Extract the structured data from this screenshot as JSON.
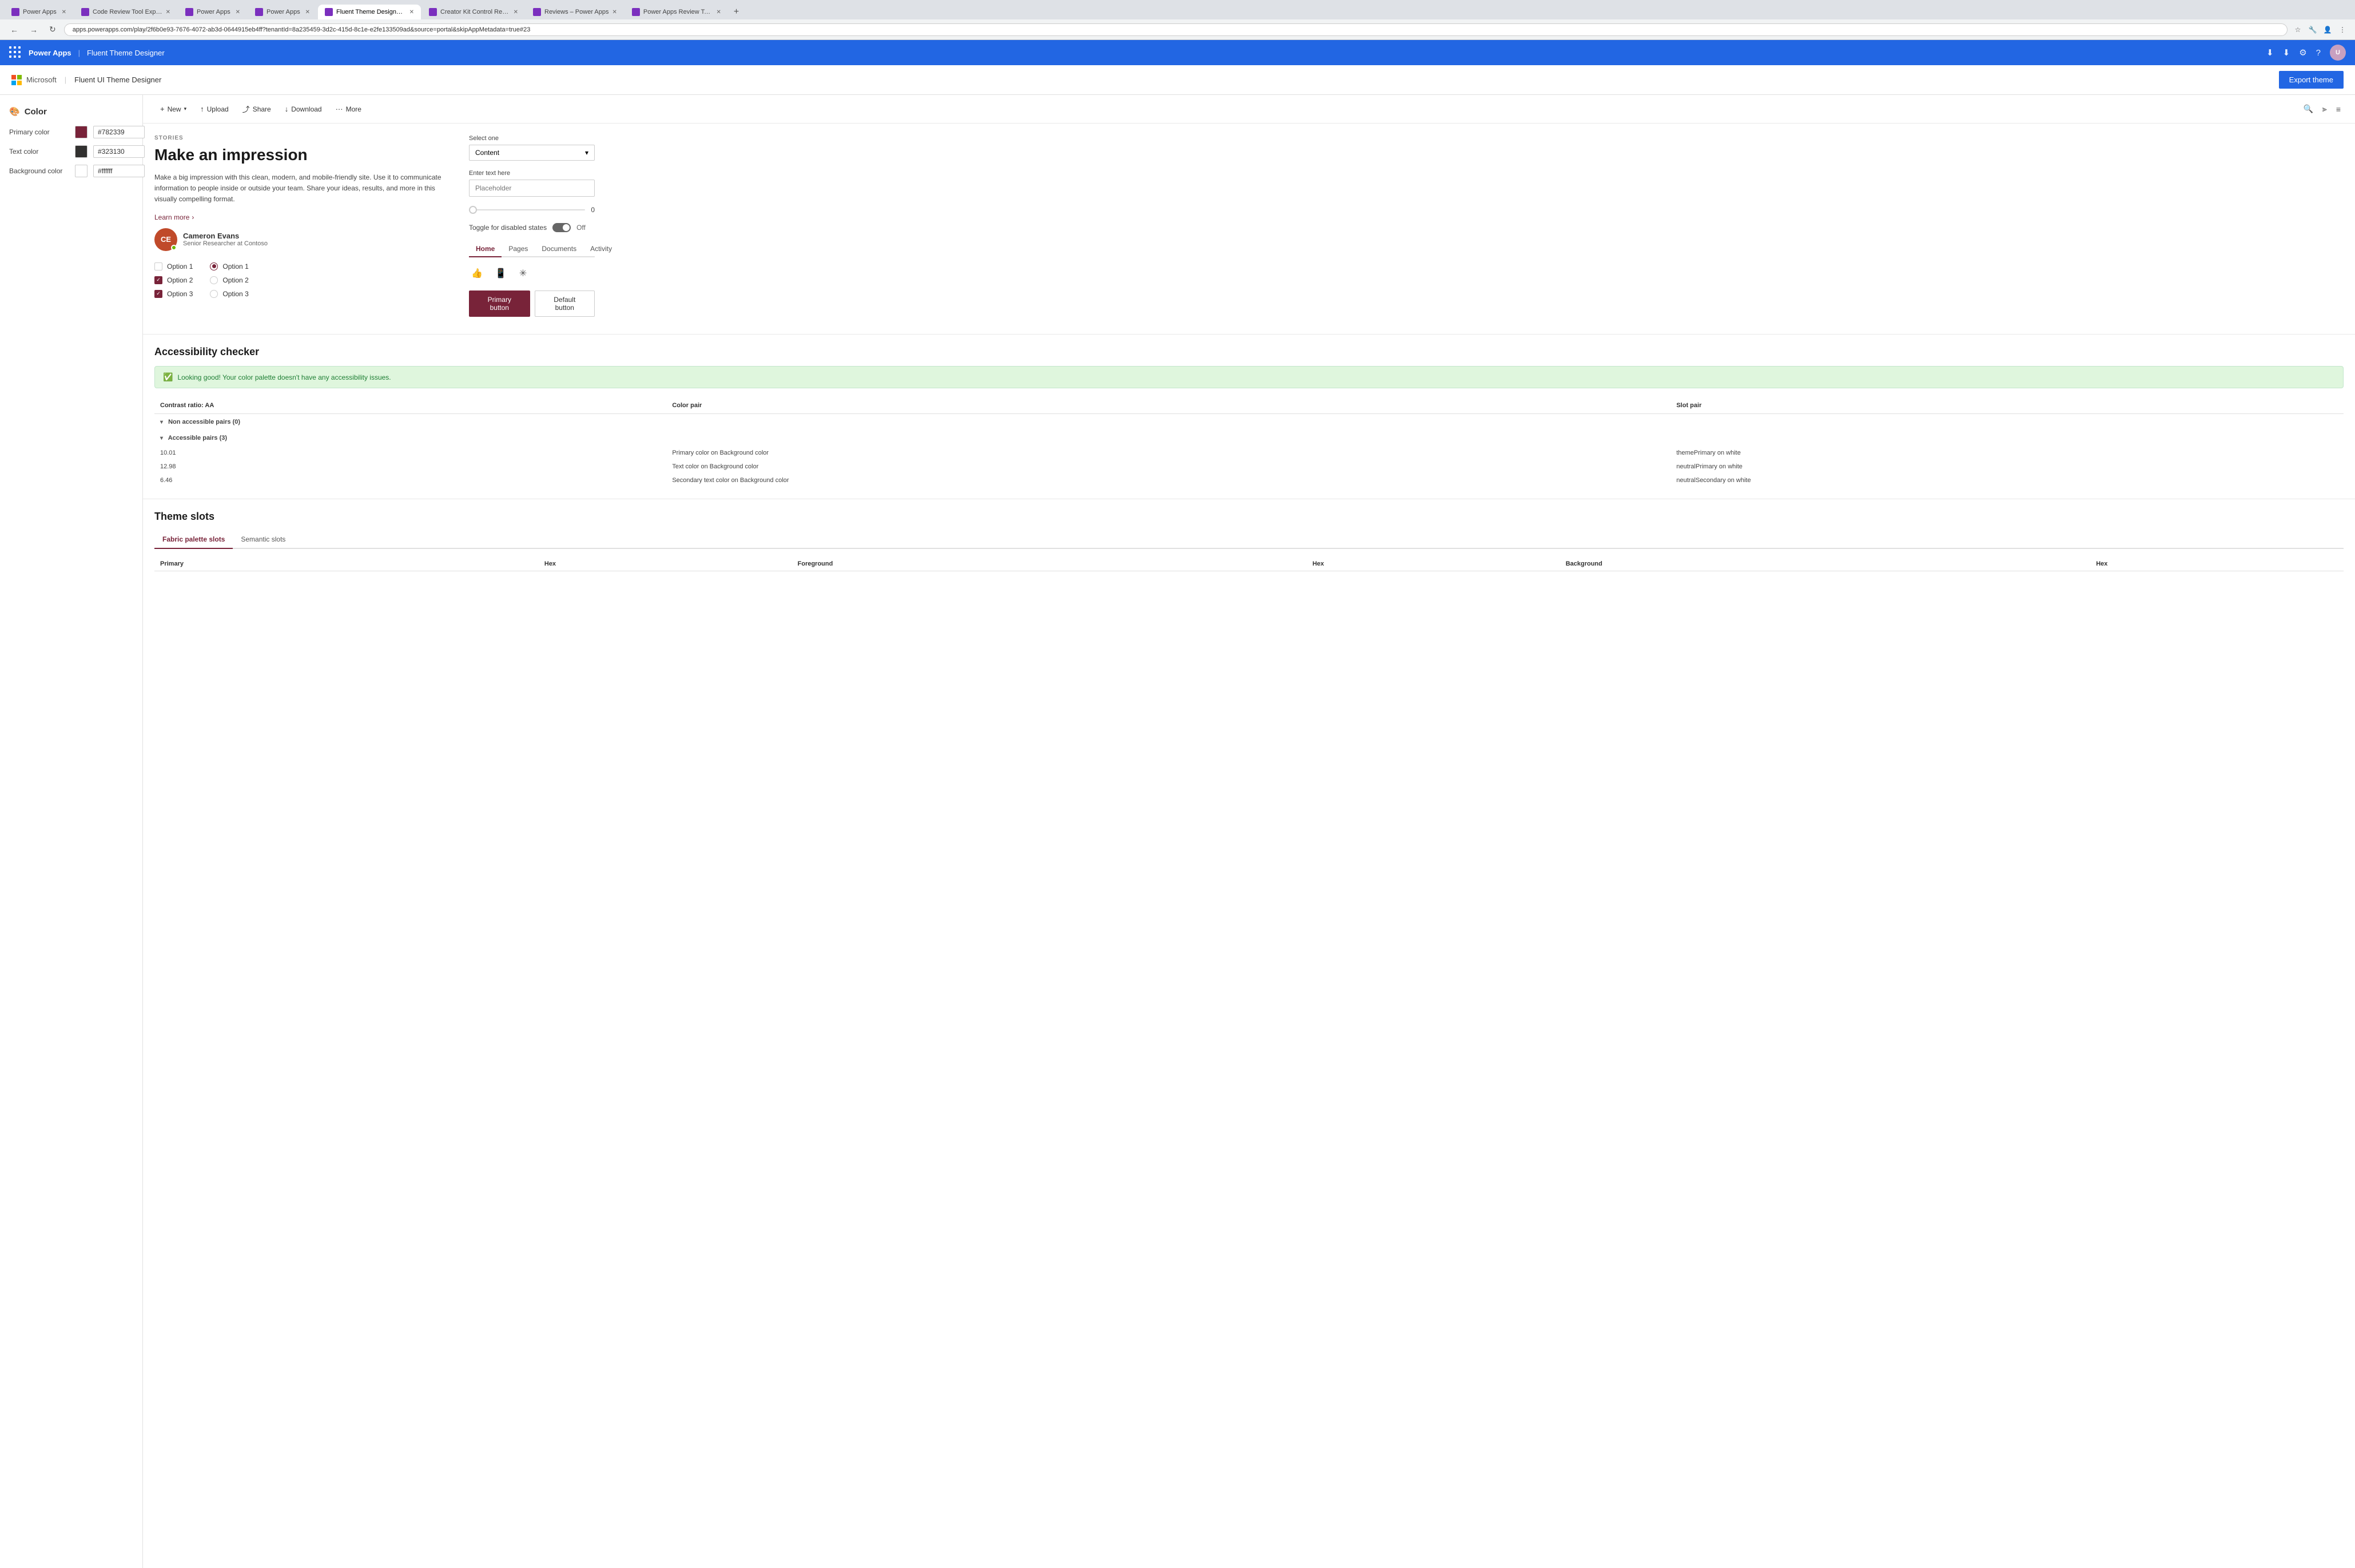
{
  "browser": {
    "tabs": [
      {
        "label": "Power Apps",
        "active": false,
        "favicon_color": "#7b2fbe"
      },
      {
        "label": "Code Review Tool Experim...",
        "active": false,
        "favicon_color": "#7b2fbe"
      },
      {
        "label": "Power Apps",
        "active": false,
        "favicon_color": "#7b2fbe"
      },
      {
        "label": "Power Apps",
        "active": false,
        "favicon_color": "#7b2fbe"
      },
      {
        "label": "Fluent Theme Designer - ...",
        "active": true,
        "favicon_color": "#7b2fbe"
      },
      {
        "label": "Creator Kit Control Refere...",
        "active": false,
        "favicon_color": "#7b2fbe"
      },
      {
        "label": "Reviews – Power Apps",
        "active": false,
        "favicon_color": "#7b2fbe"
      },
      {
        "label": "Power Apps Review Tool -...",
        "active": false,
        "favicon_color": "#7b2fbe"
      }
    ],
    "url": "apps.powerapps.com/play/2f6b0e93-7676-4072-ab3d-0644915eb4ff?tenantId=8a235459-3d2c-415d-8c1e-e2fe133509ad&source=portal&skipAppMetadata=true#23"
  },
  "powerapps_bar": {
    "title": "Power Apps",
    "separator": "|",
    "app_name": "Fluent Theme Designer"
  },
  "app_header": {
    "brand": "Microsoft",
    "separator": "|",
    "product": "Fluent UI Theme Designer",
    "export_label": "Export theme"
  },
  "sidebar": {
    "section_title": "Color",
    "section_icon": "🎨",
    "rows": [
      {
        "label": "Primary color",
        "color": "#782339",
        "value": "#782339"
      },
      {
        "label": "Text color",
        "color": "#323130",
        "value": "#323130"
      },
      {
        "label": "Background color",
        "color": "#ffffff",
        "value": "#ffffff"
      }
    ]
  },
  "toolbar": {
    "new_label": "New",
    "upload_label": "Upload",
    "share_label": "Share",
    "download_label": "Download",
    "more_label": "More"
  },
  "preview": {
    "stories_label": "STORIES",
    "headline": "Make an impression",
    "body_text": "Make a big impression with this clean, modern, and mobile-friendly site. Use it to communicate information to people inside or outside your team. Share your ideas, results, and more in this visually compelling format.",
    "learn_more": "Learn more",
    "person": {
      "initials": "CE",
      "name": "Cameron Evans",
      "title": "Senior Researcher at Contoso"
    },
    "checkboxes": [
      {
        "label": "Option 1",
        "checked": false
      },
      {
        "label": "Option 2",
        "checked": true
      },
      {
        "label": "Option 3",
        "checked": true
      }
    ],
    "radios": [
      {
        "label": "Option 1",
        "checked": true
      },
      {
        "label": "Option 2",
        "checked": false
      },
      {
        "label": "Option 3",
        "checked": false
      }
    ]
  },
  "right_panel": {
    "select_label": "Select one",
    "select_value": "Content",
    "slider_value": "0",
    "toggle_label": "Toggle for disabled states",
    "toggle_state": "Off",
    "nav_tabs": [
      {
        "label": "Home",
        "active": true
      },
      {
        "label": "Pages",
        "active": false
      },
      {
        "label": "Documents",
        "active": false
      },
      {
        "label": "Activity",
        "active": false
      }
    ],
    "primary_btn": "Primary button",
    "default_btn": "Default button",
    "input_label": "Enter text here",
    "input_placeholder": "Placeholder"
  },
  "accessibility": {
    "title": "Accessibility checker",
    "success_msg": "Looking good! Your color palette doesn't have any accessibility issues.",
    "table_headers": [
      "Contrast ratio: AA",
      "Color pair",
      "Slot pair"
    ],
    "non_accessible": {
      "label": "Non accessible pairs (0)",
      "count": 0
    },
    "accessible": {
      "label": "Accessible pairs (3)",
      "count": 3,
      "rows": [
        {
          "ratio": "10.01",
          "color_pair": "Primary color on Background color",
          "slot_pair": "themePrimary on white"
        },
        {
          "ratio": "12.98",
          "color_pair": "Text color on Background color",
          "slot_pair": "neutralPrimary on white"
        },
        {
          "ratio": "6.46",
          "color_pair": "Secondary text color on Background color",
          "slot_pair": "neutralSecondary on white"
        }
      ]
    }
  },
  "theme_slots": {
    "title": "Theme slots",
    "tabs": [
      {
        "label": "Fabric palette slots",
        "active": true
      },
      {
        "label": "Semantic slots",
        "active": false
      }
    ],
    "table_headers": [
      "Primary",
      "Hex",
      "Foreground",
      "Hex",
      "Background",
      "Hex"
    ]
  }
}
